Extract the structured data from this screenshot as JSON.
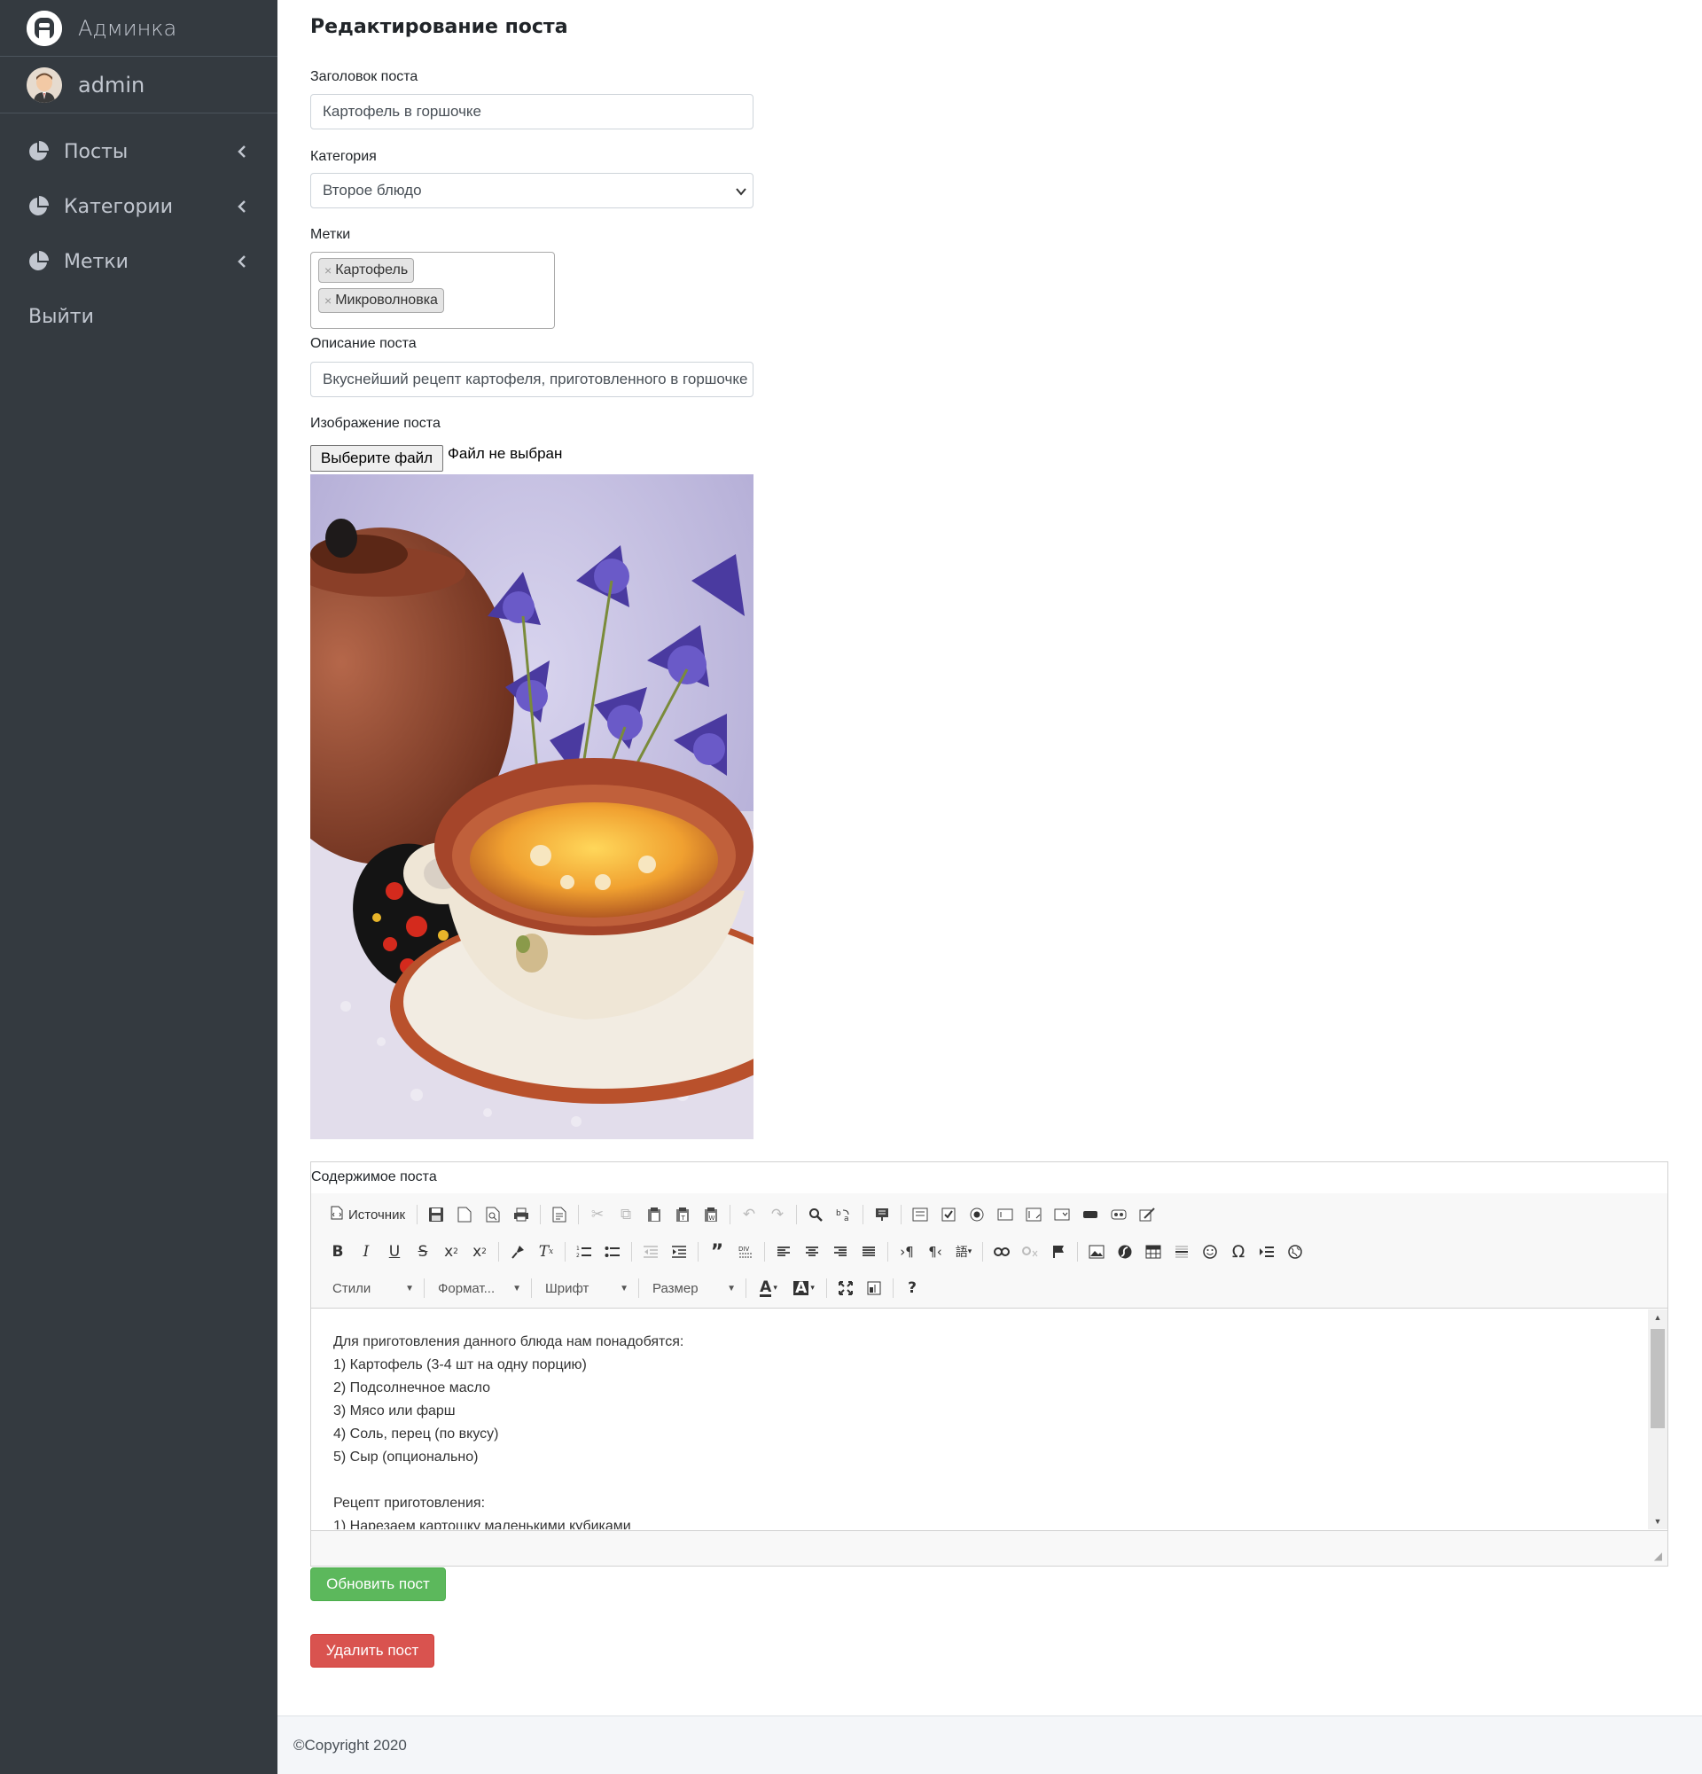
{
  "sidebar": {
    "brand": "Админка",
    "user": "admin",
    "nav": [
      {
        "label": "Посты"
      },
      {
        "label": "Категории"
      },
      {
        "label": "Метки"
      }
    ],
    "logout": "Выйти"
  },
  "form": {
    "page_title": "Редактирование поста",
    "title_label": "Заголовок поста",
    "title_value": "Картофель в горшочке",
    "category_label": "Категория",
    "category_value": "Второе блюдо",
    "tags_label": "Метки",
    "tags": [
      "Картофель",
      "Микроволновка"
    ],
    "description_label": "Описание поста",
    "description_value": "Вкуснейший рецепт картофеля, приготовленного в горшочке",
    "image_label": "Изображение поста",
    "file_button": "Выберите файл",
    "file_status": "Файл не выбран"
  },
  "editor": {
    "label": "Содержимое поста",
    "source_label": "Источник",
    "combos": [
      "Стили",
      "Формат...",
      "Шрифт",
      "Размер"
    ],
    "content_lines": [
      "Для приготовления данного блюда нам понадобятся:",
      "1) Картофель (3-4 шт на одну порцию)",
      "2) Подсолнечное масло",
      "3) Мясо или фарш",
      "4) Соль, перец (по вкусу)",
      "5) Сыр (опционально)",
      "",
      "Рецепт приготовления:",
      "1) Нарезаем картошку маленькими кубиками"
    ]
  },
  "buttons": {
    "update": "Обновить пост",
    "delete": "Удалить пост"
  },
  "footer": {
    "copyright": "©Copyright 2020"
  }
}
